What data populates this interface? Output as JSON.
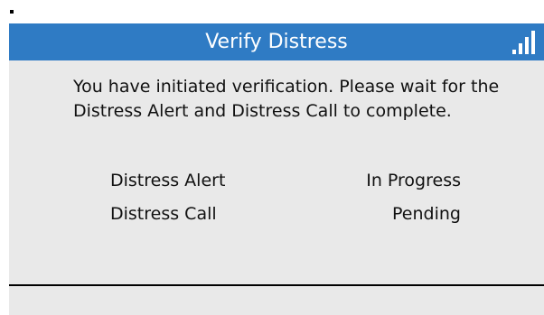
{
  "dialog": {
    "title": "Verify Distress",
    "message": "You have initiated verification. Please wait for the Distress Alert and Distress Call to complete.",
    "signal_icon": "signal-strength-icon"
  },
  "status": [
    {
      "label": "Distress Alert",
      "value": "In Progress"
    },
    {
      "label": "Distress Call",
      "value": "Pending"
    }
  ],
  "colors": {
    "title_bar": "#2f7bc4",
    "panel": "#e9e9e9",
    "text": "#111111"
  }
}
